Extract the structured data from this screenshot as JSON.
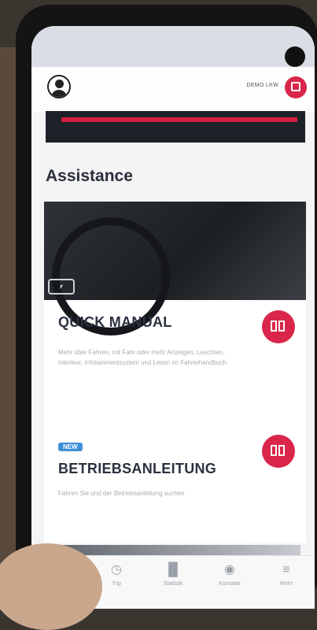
{
  "header": {
    "vehicle_name": "DEMO LKW"
  },
  "banner": {
    "accent_color": "#d31f3d"
  },
  "assistance": {
    "section_title": "Assistance"
  },
  "cards": {
    "quick_manual": {
      "title": "QUICK MANUAL",
      "description": "Mehr über Fahren, mit Fahr oder mehr Anzeigen, Leuchten, Interieur, Infotainmentsystem und Lesen im Fahrerhandbuch.",
      "icon": "book-icon",
      "chip_icon": "driver-seat-icon"
    },
    "betriebsanleitung": {
      "badge": "NEW",
      "title": "BETRIEBSANLEITUNG",
      "description": "Fahren Sie und der Betriebsanleitung suchen",
      "icon": "book-icon"
    }
  },
  "tabbar": {
    "items": [
      {
        "label": "",
        "icon": "check-icon"
      },
      {
        "label": "Trip",
        "icon": "clock-icon"
      },
      {
        "label": "Statistik",
        "icon": "bar-chart-icon"
      },
      {
        "label": "Kontakte",
        "icon": "target-icon"
      },
      {
        "label": "Mehr",
        "icon": "menu-icon"
      }
    ]
  },
  "colors": {
    "brand_red": "#d9264a",
    "badge_blue": "#3d8fd6",
    "title_dark": "#2b3140"
  }
}
